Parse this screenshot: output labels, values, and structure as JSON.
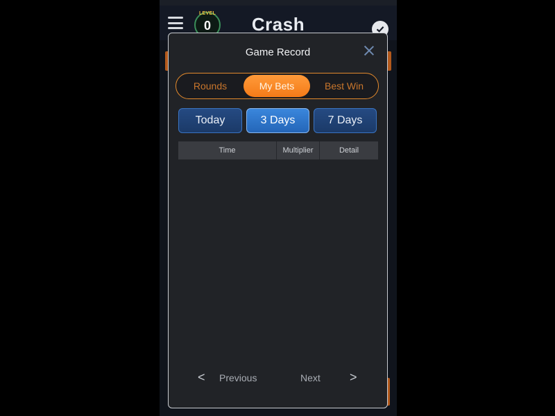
{
  "app": {
    "title": "Crash",
    "level_label": "LEVEL",
    "level_value": "0"
  },
  "modal": {
    "title": "Game Record",
    "tabs": [
      {
        "label": "Rounds"
      },
      {
        "label": "My Bets"
      },
      {
        "label": "Best Win"
      }
    ],
    "active_tab": "My Bets",
    "ranges": [
      {
        "label": "Today"
      },
      {
        "label": "3 Days"
      },
      {
        "label": "7 Days"
      }
    ],
    "active_range": "3 Days",
    "table": {
      "columns": [
        "Time",
        "Multiplier",
        "Detail"
      ],
      "rows": []
    },
    "pager": {
      "prev_arrow": "<",
      "prev_label": "Previous",
      "next_label": "Next",
      "next_arrow": ">"
    }
  },
  "icons": {
    "menu": "hamburger-icon",
    "close": "close-icon",
    "verified": "verified-badge-icon"
  },
  "colors": {
    "accent_orange": "#f47b18",
    "accent_blue": "#2466b8",
    "modal_bg": "#212327"
  }
}
